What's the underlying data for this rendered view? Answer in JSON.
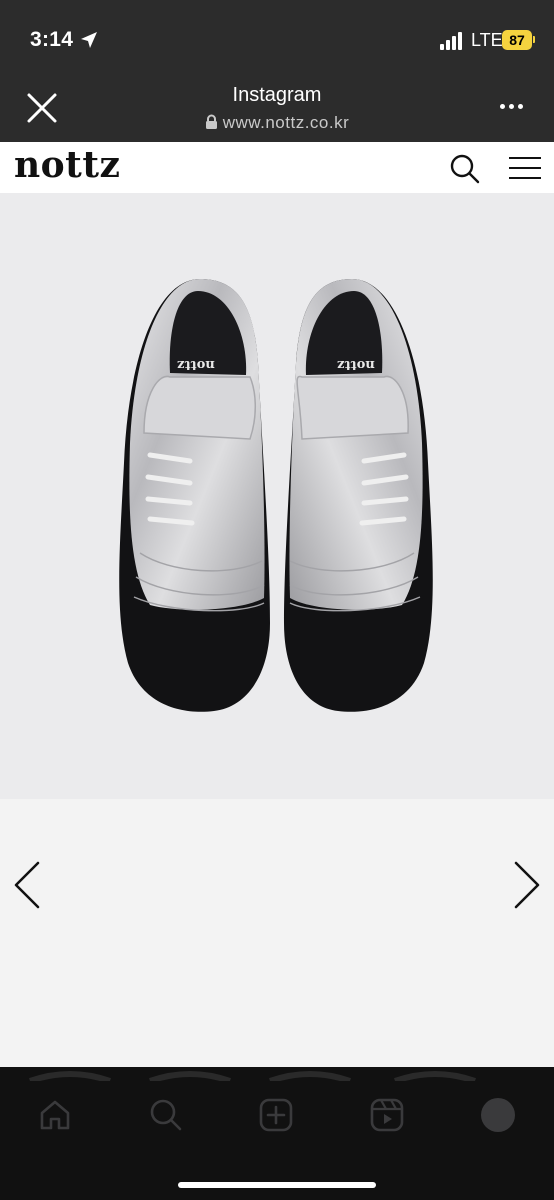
{
  "status_bar": {
    "time": "3:14",
    "network": "LTE",
    "battery": "87",
    "icons": [
      "location-arrow-icon",
      "signal-bars-icon",
      "battery-icon"
    ]
  },
  "browser": {
    "title": "Instagram",
    "url": "www.nottz.co.kr",
    "icons": [
      "close-icon",
      "lock-icon",
      "more-icon"
    ]
  },
  "site": {
    "logo": "nottz",
    "icons": [
      "search-icon",
      "hamburger-menu-icon"
    ]
  },
  "product": {
    "insole_brand": "nottz",
    "colors": {
      "upper": "#c9c9cc",
      "sole": "#111111",
      "laces": "#eeeeee"
    }
  },
  "carousel": {
    "icons": [
      "chevron-left-icon",
      "chevron-right-icon"
    ]
  },
  "instagram_nav": {
    "items": [
      "home-icon",
      "search-icon",
      "create-icon",
      "reels-icon",
      "profile-avatar"
    ]
  },
  "colors": {
    "chrome": "#2c2c2c",
    "battery": "#f5d33f",
    "image_bg": "#ebebed",
    "page_bg": "#f3f3f3",
    "nav_bg": "#111111"
  }
}
